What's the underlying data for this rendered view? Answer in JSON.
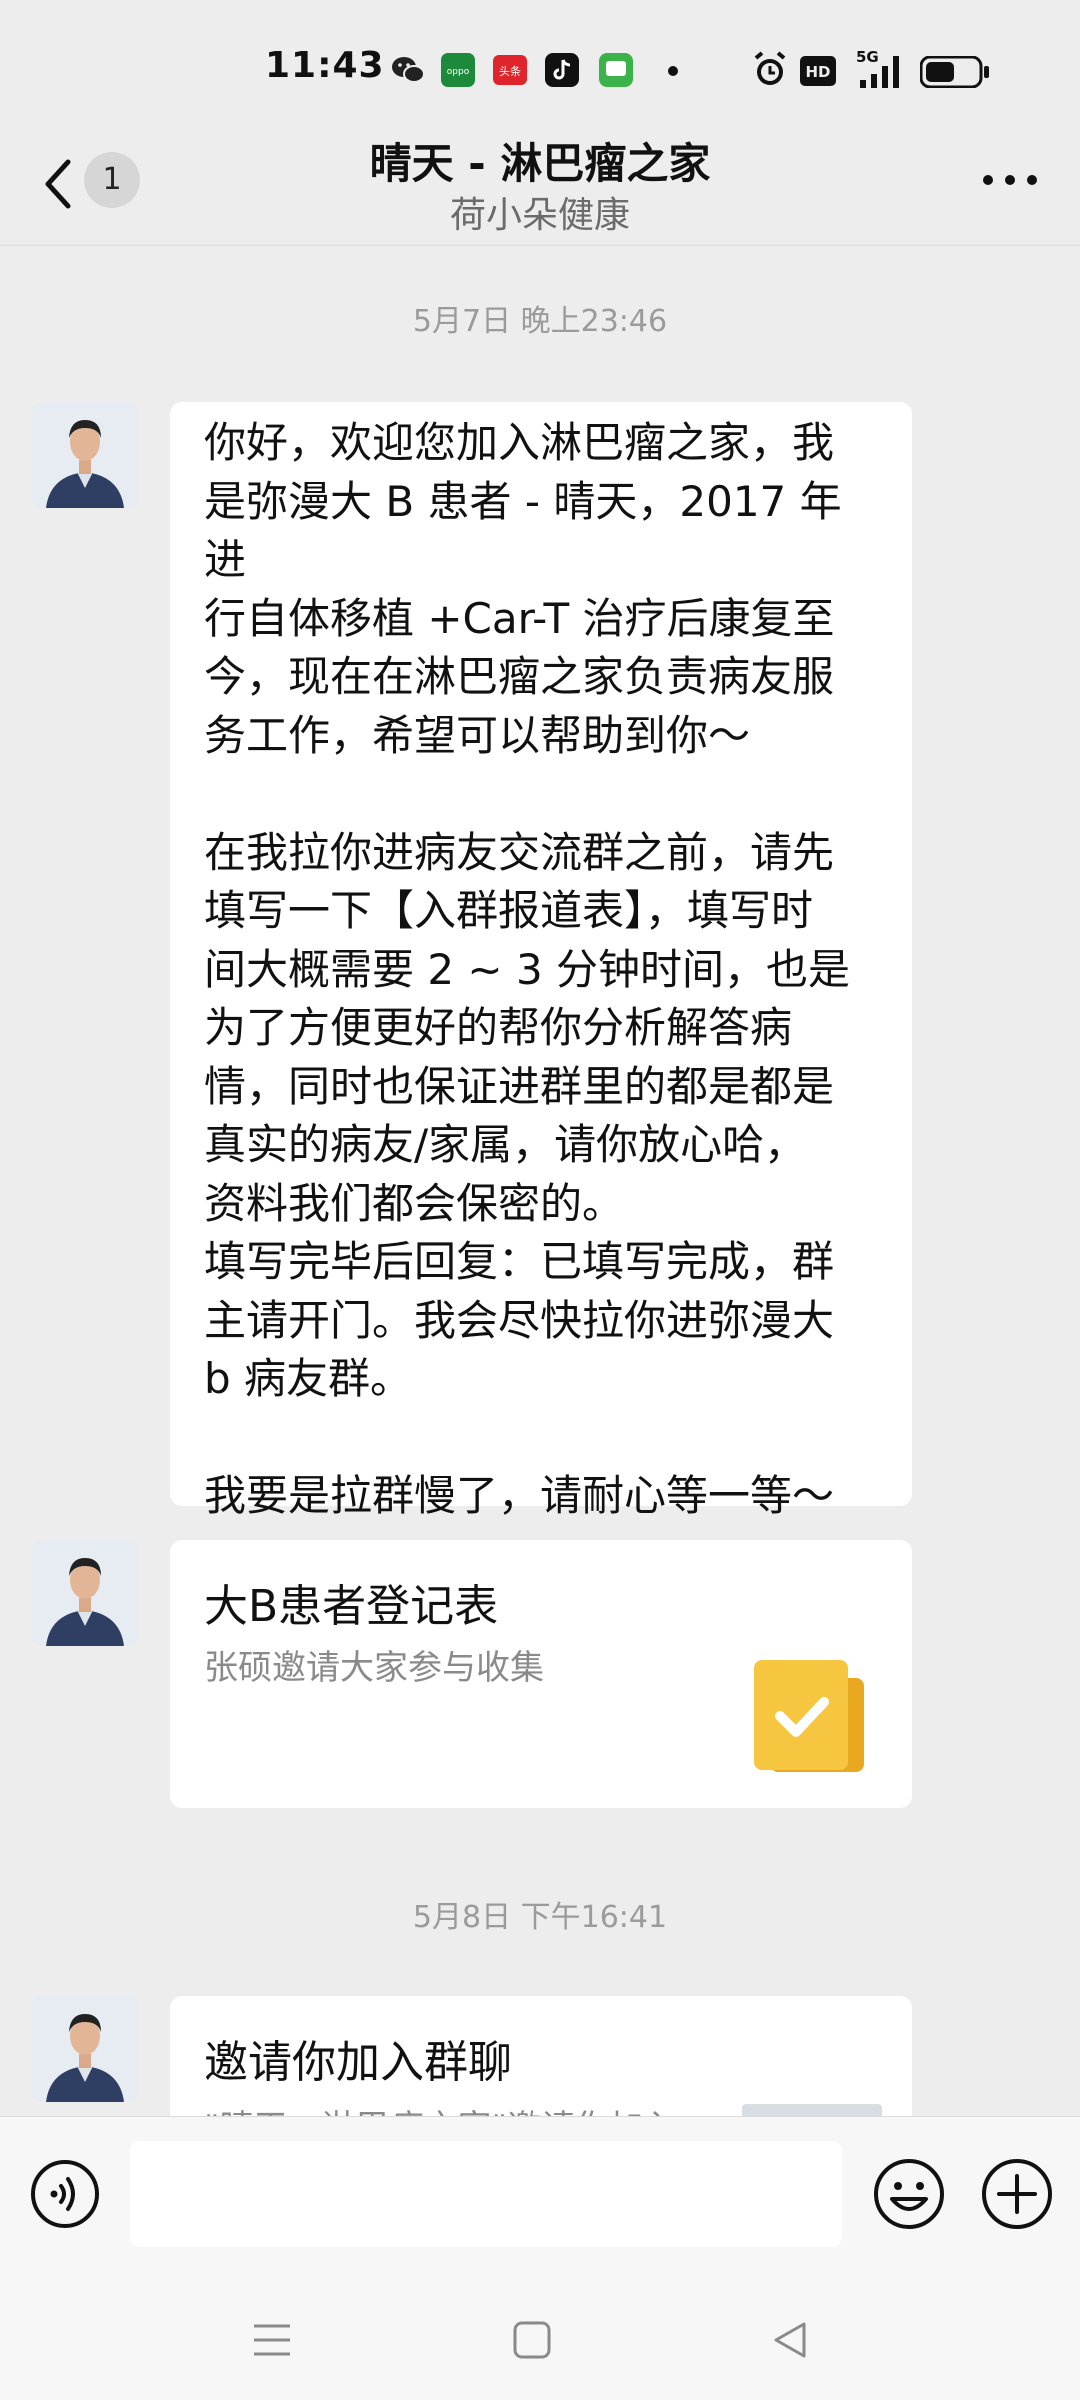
{
  "status_bar": {
    "time": "11:43",
    "app_icons": [
      "wechat-icon",
      "oppo-icon",
      "toutiao-icon",
      "tiktok-icon",
      "messages-icon"
    ],
    "toutiao_label": "头条",
    "oppo_label": "oppo",
    "hd_label": "HD",
    "network_label": "5G",
    "battery_level": 0.55
  },
  "header": {
    "unread_count": "1",
    "title": "晴天 - 淋巴瘤之家",
    "subtitle": "荷小朵健康"
  },
  "chat": {
    "timestamps": [
      "5月7日 晚上23:46",
      "5月8日 下午16:41"
    ],
    "messages": [
      {
        "type": "text",
        "text": "你好，欢迎您加入淋巴瘤之家，我\n是弥漫大 B 患者 - 晴天，2017 年进\n行自体移植 +Car-T 治疗后康复至\n今，现在在淋巴瘤之家负责病友服\n务工作，希望可以帮助到你～\n\n在我拉你进病友交流群之前，请先\n填写一下【入群报道表】，填写时\n间大概需要 2 ~ 3 分钟时间，也是\n为了方便更好的帮你分析解答病\n情，同时也保证进群里的都是都是\n真实的病友/家属，请你放心哈，\n资料我们都会保密的。\n填写完毕后回复：已填写完成，群\n主请开门。我会尽快拉你进弥漫大\nb 病友群。\n\n我要是拉群慢了，请耐心等一等～"
      },
      {
        "type": "card",
        "title": "大B患者登记表",
        "description": "张硕邀请大家参与收集",
        "icon": "form-check-icon",
        "icon_color": "#f6c640"
      },
      {
        "type": "invite",
        "title": "邀请你加入群聊",
        "description_partial": "\"晴天 - 淋巴瘤之家\"邀请你加入"
      }
    ]
  },
  "input_bar": {
    "placeholder": ""
  }
}
